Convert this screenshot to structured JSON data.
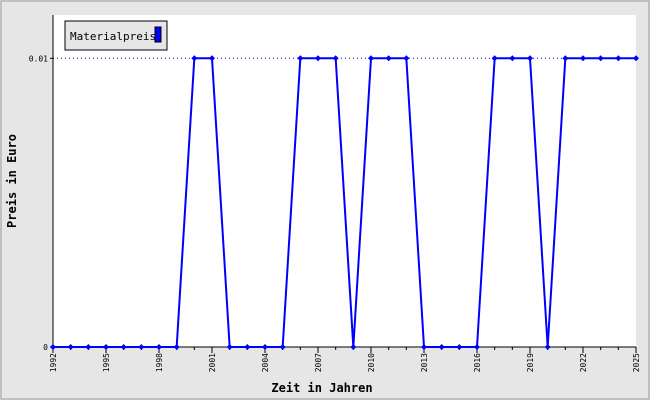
{
  "chart_data": {
    "type": "line",
    "title": "",
    "xlabel": "Zeit in Jahren",
    "ylabel": "Preis in Euro",
    "xlim": [
      1992,
      2025
    ],
    "ylim": [
      0,
      0.0115
    ],
    "x_ticks": [
      "1992",
      "1995",
      "1998",
      "2001",
      "2004",
      "2007",
      "2010",
      "2013",
      "2016",
      "2019",
      "2022",
      "2025"
    ],
    "y_ticks": [
      {
        "value": 0,
        "label": "0"
      },
      {
        "value": 0.01,
        "label": "0.01"
      }
    ],
    "legend_position": "top-left",
    "grid": "horizontal dotted",
    "series": [
      {
        "name": "Materialpreis",
        "color": "#0000ff",
        "x": [
          1992,
          1993,
          1994,
          1995,
          1996,
          1997,
          1998,
          1999,
          2000,
          2001,
          2002,
          2003,
          2004,
          2005,
          2006,
          2007,
          2008,
          2009,
          2010,
          2011,
          2012,
          2013,
          2014,
          2015,
          2016,
          2017,
          2018,
          2019,
          2020,
          2021,
          2022,
          2023,
          2024,
          2025
        ],
        "values": [
          0,
          0,
          0,
          0,
          0,
          0,
          0,
          0,
          0.01,
          0.01,
          0,
          0,
          0,
          0,
          0.01,
          0.01,
          0.01,
          0,
          0.01,
          0.01,
          0.01,
          0,
          0,
          0,
          0,
          0.01,
          0.01,
          0.01,
          0,
          0.01,
          0.01,
          0.01,
          0.01,
          0.01
        ]
      }
    ]
  }
}
